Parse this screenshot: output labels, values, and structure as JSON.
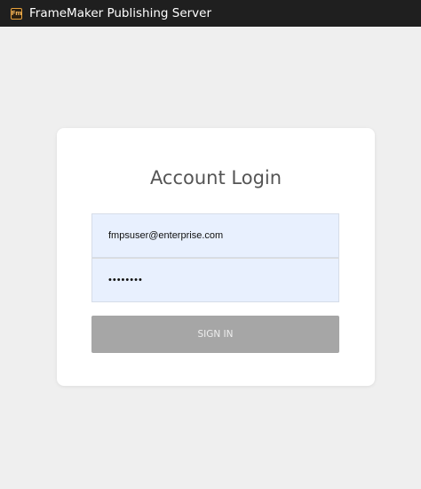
{
  "header": {
    "app_icon_label": "Fm",
    "title": "FrameMaker Publishing Server"
  },
  "login": {
    "title": "Account Login",
    "email_value": "fmpsuser@enterprise.com",
    "password_masked": "••••••••",
    "signin_label": "SIGN IN"
  },
  "colors": {
    "header_bg": "#1f1f1f",
    "page_bg": "#efefef",
    "field_bg": "#e8f0fe",
    "button_bg": "#a6a6a6"
  }
}
